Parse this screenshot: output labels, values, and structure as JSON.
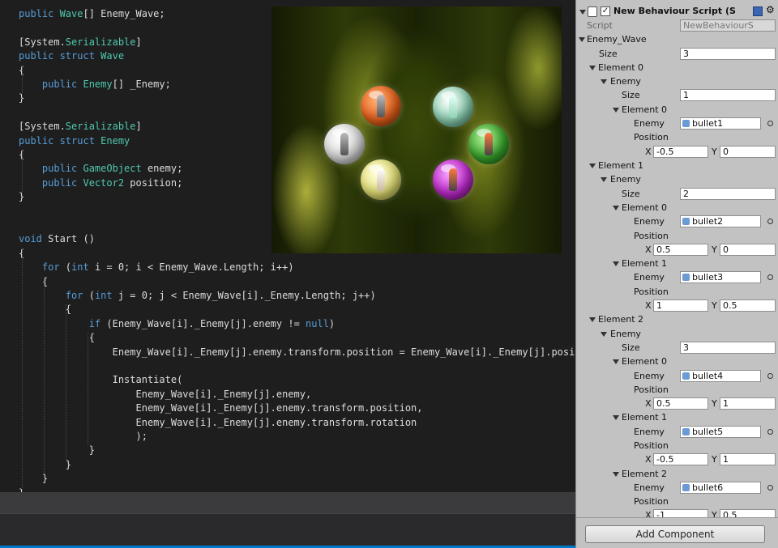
{
  "code": [
    [
      [
        "public ",
        "k"
      ],
      [
        "Wave",
        "t"
      ],
      [
        "[] Enemy_Wave;",
        "p"
      ]
    ],
    [],
    [
      [
        "[System.",
        "p"
      ],
      [
        "Serializable",
        "t"
      ],
      [
        "]",
        "p"
      ]
    ],
    [
      [
        "public struct ",
        "k"
      ],
      [
        "Wave",
        "t"
      ]
    ],
    [
      [
        "{",
        "p"
      ]
    ],
    [
      [
        "    public ",
        "k"
      ],
      [
        "Enemy",
        "t"
      ],
      [
        "[] _Enemy;",
        "p"
      ]
    ],
    [
      [
        "}",
        "p"
      ]
    ],
    [],
    [
      [
        "[System.",
        "p"
      ],
      [
        "Serializable",
        "t"
      ],
      [
        "]",
        "p"
      ]
    ],
    [
      [
        "public struct ",
        "k"
      ],
      [
        "Enemy",
        "t"
      ]
    ],
    [
      [
        "{",
        "p"
      ]
    ],
    [
      [
        "    public ",
        "k"
      ],
      [
        "GameObject",
        "t"
      ],
      [
        " enemy;",
        "p"
      ]
    ],
    [
      [
        "    public ",
        "k"
      ],
      [
        "Vector2",
        "t"
      ],
      [
        " position;",
        "p"
      ]
    ],
    [
      [
        "}",
        "p"
      ]
    ],
    [],
    [],
    [
      [
        "void ",
        "k"
      ],
      [
        "Start ()",
        "p"
      ]
    ],
    [
      [
        "{",
        "p"
      ]
    ],
    [
      [
        "    for ",
        "k"
      ],
      [
        "(",
        "p"
      ],
      [
        "int ",
        "k"
      ],
      [
        "i = 0; i < Enemy_Wave.Length; i++)",
        "p"
      ]
    ],
    [
      [
        "    {",
        "p"
      ]
    ],
    [
      [
        "        for ",
        "k"
      ],
      [
        "(",
        "p"
      ],
      [
        "int ",
        "k"
      ],
      [
        "j = 0; j < Enemy_Wave[i]._Enemy.Length; j++)",
        "p"
      ]
    ],
    [
      [
        "        {",
        "p"
      ]
    ],
    [
      [
        "            if ",
        "k"
      ],
      [
        "(Enemy_Wave[i]._Enemy[j].enemy != ",
        "p"
      ],
      [
        "null",
        "k"
      ],
      [
        ")",
        "p"
      ]
    ],
    [
      [
        "            {",
        "p"
      ]
    ],
    [
      [
        "                Enemy_Wave[i]._Enemy[j].enemy.transform.position = Enemy_Wave[i]._Enemy[j].position;",
        "p"
      ]
    ],
    [],
    [
      [
        "                Instantiate(",
        "p"
      ]
    ],
    [
      [
        "                    Enemy_Wave[i]._Enemy[j].enemy,",
        "p"
      ]
    ],
    [
      [
        "                    Enemy_Wave[i]._Enemy[j].enemy.transform.position,",
        "p"
      ]
    ],
    [
      [
        "                    Enemy_Wave[i]._Enemy[j].enemy.transform.rotation",
        "p"
      ]
    ],
    [
      [
        "                    );",
        "p"
      ]
    ],
    [
      [
        "            }",
        "p"
      ]
    ],
    [
      [
        "        }",
        "p"
      ]
    ],
    [
      [
        "    }",
        "p"
      ]
    ],
    [
      [
        "}",
        "p"
      ]
    ]
  ],
  "inspector": {
    "component_title": "New Behaviour Script (S",
    "script_label": "Script",
    "script_value": "NewBehaviourS",
    "array_name": "Enemy_Wave",
    "size_label": "Size",
    "wave_size": "3",
    "element_prefix": "Element",
    "enemy_label": "Enemy",
    "position_label": "Position",
    "x_label": "X",
    "y_label": "Y",
    "waves": [
      {
        "label": "Element 0",
        "size": "1",
        "enemies": [
          {
            "label": "Element 0",
            "enemy": "bullet1",
            "x": "-0.5",
            "y": "0"
          }
        ]
      },
      {
        "label": "Element 1",
        "size": "2",
        "enemies": [
          {
            "label": "Element 0",
            "enemy": "bullet2",
            "x": "0.5",
            "y": "0"
          },
          {
            "label": "Element 1",
            "enemy": "bullet3",
            "x": "1",
            "y": "0.5"
          }
        ]
      },
      {
        "label": "Element 2",
        "size": "3",
        "enemies": [
          {
            "label": "Element 0",
            "enemy": "bullet4",
            "x": "0.5",
            "y": "1"
          },
          {
            "label": "Element 1",
            "enemy": "bullet5",
            "x": "-0.5",
            "y": "1"
          },
          {
            "label": "Element 2",
            "enemy": "bullet6",
            "x": "-1",
            "y": "0.5"
          }
        ]
      }
    ],
    "add_component_label": "Add Component"
  },
  "preview": {
    "orbs": [
      {
        "name": "orb-orange",
        "color": "#e8641e"
      },
      {
        "name": "orb-teal",
        "color": "#8fd2b4"
      },
      {
        "name": "orb-white",
        "color": "#e0e0e0"
      },
      {
        "name": "orb-green",
        "color": "#3aa62c"
      },
      {
        "name": "orb-yellow",
        "color": "#e6e27a"
      },
      {
        "name": "orb-magenta",
        "color": "#c22ccf"
      }
    ]
  }
}
